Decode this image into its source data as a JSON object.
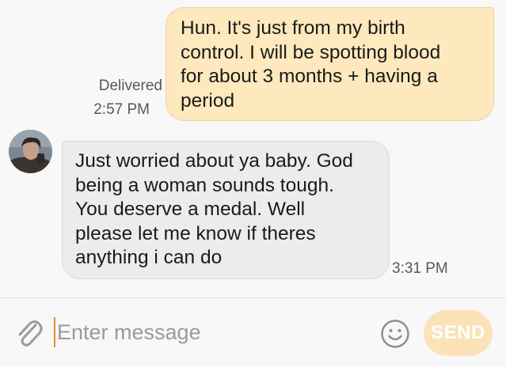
{
  "thread": {
    "messages": [
      {
        "direction": "outgoing",
        "text": "Hun. It's just from my birth\ncontrol. I will be spotting blood\nfor about 3 months + having a\nperiod",
        "status": "Delivered",
        "time": "2:57 PM"
      },
      {
        "direction": "incoming",
        "text": "Just worried about ya baby. God\nbeing a woman sounds tough.\nYou deserve a medal. Well\nplease let me know if theres\nanything i can do",
        "time": "3:31 PM"
      }
    ]
  },
  "composer": {
    "placeholder": "Enter message",
    "send_label": "SEND",
    "attach_icon": "paperclip-icon",
    "emoji_icon": "smiley-icon"
  },
  "colors": {
    "outgoing_bubble": "#fde9bd",
    "incoming_bubble": "#ececec",
    "send_button": "#fce2b9",
    "caret": "#ef8a2f"
  }
}
